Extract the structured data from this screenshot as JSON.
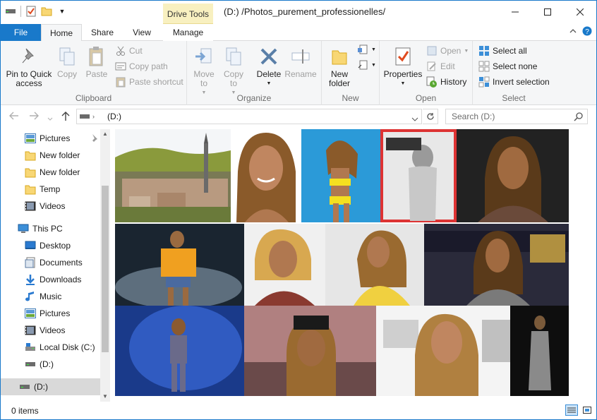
{
  "window": {
    "path_title": "(D:) /Photos_purement_professionelles/",
    "context_tab": "Drive Tools"
  },
  "tabs": [
    "File",
    "Home",
    "Share",
    "View",
    "Manage"
  ],
  "ribbon": {
    "clipboard": {
      "label": "Clipboard",
      "pin": "Pin to Quick access",
      "copy": "Copy",
      "paste": "Paste",
      "cut": "Cut",
      "copy_path": "Copy path",
      "paste_shortcut": "Paste shortcut"
    },
    "organize": {
      "label": "Organize",
      "move_to": "Move to",
      "copy_to": "Copy to",
      "delete": "Delete",
      "rename": "Rename"
    },
    "new": {
      "label": "New",
      "new_folder": "New folder"
    },
    "open": {
      "label": "Open",
      "properties": "Properties",
      "open": "Open",
      "edit": "Edit",
      "history": "History"
    },
    "select": {
      "label": "Select",
      "select_all": "Select all",
      "select_none": "Select none",
      "invert": "Invert selection"
    }
  },
  "address": {
    "location": "(D:)",
    "search_placeholder": "Search  (D:)"
  },
  "nav": {
    "items": [
      {
        "label": "Pictures",
        "icon": "pictures-icon",
        "pinned": true
      },
      {
        "label": "New folder",
        "icon": "folder-icon"
      },
      {
        "label": "New folder",
        "icon": "folder-icon"
      },
      {
        "label": "Temp",
        "icon": "folder-icon"
      },
      {
        "label": "Videos",
        "icon": "videos-icon"
      },
      {
        "label": "This PC",
        "icon": "computer-icon"
      },
      {
        "label": "Desktop",
        "icon": "desktop-icon"
      },
      {
        "label": "Documents",
        "icon": "documents-icon"
      },
      {
        "label": "Downloads",
        "icon": "downloads-icon"
      },
      {
        "label": "Music",
        "icon": "music-icon"
      },
      {
        "label": "Pictures",
        "icon": "pictures-icon"
      },
      {
        "label": "Videos",
        "icon": "videos-icon"
      },
      {
        "label": "Local Disk (C:)",
        "icon": "disk-icon"
      },
      {
        "label": "(D:)",
        "icon": "drive-icon"
      },
      {
        "label": "(D:)",
        "icon": "drive-icon",
        "selected": true
      }
    ]
  },
  "status": {
    "items_count": "0 items"
  },
  "colors": {
    "accent": "#1979ca",
    "tools_tab": "#f8f0c0"
  }
}
